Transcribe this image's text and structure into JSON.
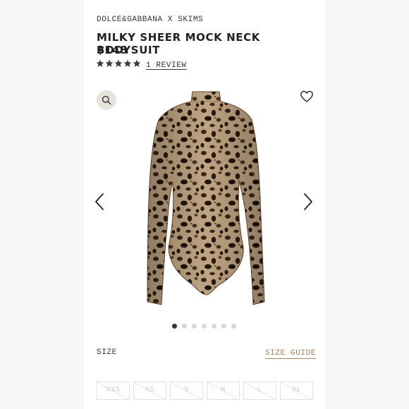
{
  "product": {
    "brand": "DOLCE&GABBANA X SKIMS",
    "title": "MILKY SHEER MOCK NECK BODYSUIT",
    "price": "$148",
    "rating": 5,
    "reviews_link": "1 REVIEW"
  },
  "icons": {
    "zoom": "search-icon",
    "wishlist": "heart-icon",
    "prev": "chevron-left-icon",
    "next": "chevron-right-icon",
    "star": "star-icon"
  },
  "carousel": {
    "total": 7,
    "active_index": 0
  },
  "size": {
    "label": "SIZE",
    "guide_link": "SIZE GUIDE",
    "options": [
      "XXS",
      "XS",
      "S",
      "M",
      "L",
      "XL"
    ],
    "unavailable": true
  },
  "colors": {
    "accent": "#a87c5e",
    "zoom_bg": "#e6e2dc",
    "star": "#3a3a3a"
  }
}
